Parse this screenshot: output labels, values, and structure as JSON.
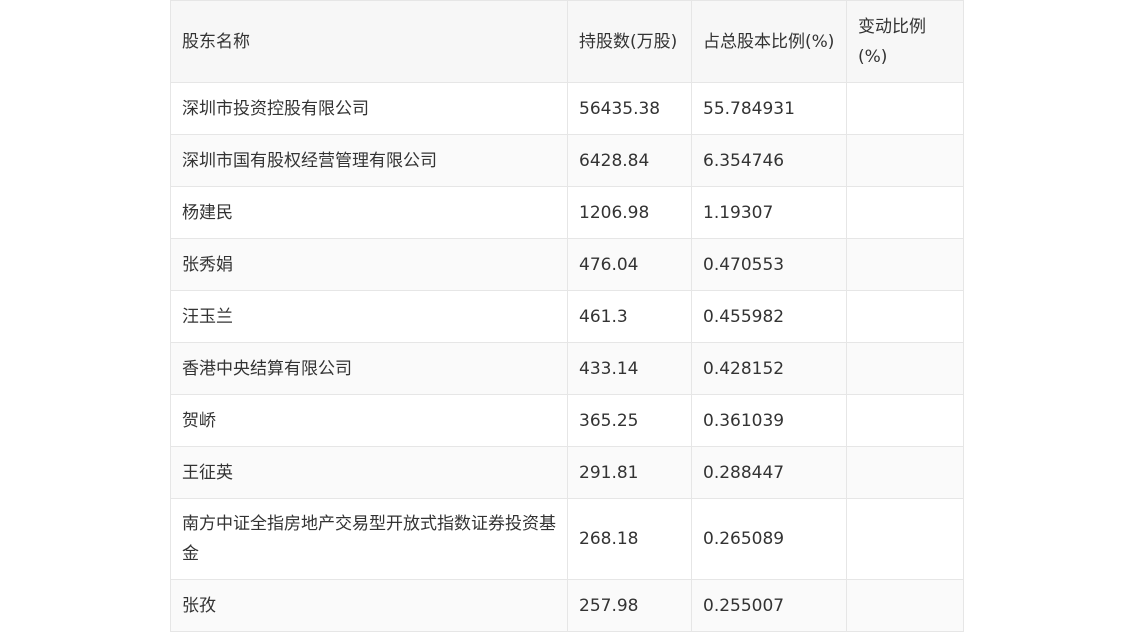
{
  "table": {
    "headers": [
      "股东名称",
      "持股数(万股)",
      "占总股本比例(%)",
      "变动比例(%)"
    ],
    "rows": [
      {
        "name": "深圳市投资控股有限公司",
        "shares": "56435.38",
        "ratio": "55.784931",
        "change": ""
      },
      {
        "name": "深圳市国有股权经营管理有限公司",
        "shares": "6428.84",
        "ratio": "6.354746",
        "change": ""
      },
      {
        "name": "杨建民",
        "shares": "1206.98",
        "ratio": "1.19307",
        "change": ""
      },
      {
        "name": "张秀娟",
        "shares": "476.04",
        "ratio": "0.470553",
        "change": ""
      },
      {
        "name": "汪玉兰",
        "shares": "461.3",
        "ratio": "0.455982",
        "change": ""
      },
      {
        "name": "香港中央结算有限公司",
        "shares": "433.14",
        "ratio": "0.428152",
        "change": ""
      },
      {
        "name": "贺峤",
        "shares": "365.25",
        "ratio": "0.361039",
        "change": ""
      },
      {
        "name": "王征英",
        "shares": "291.81",
        "ratio": "0.288447",
        "change": ""
      },
      {
        "name": "南方中证全指房地产交易型开放式指数证券投资基金",
        "shares": "268.18",
        "ratio": "0.265089",
        "change": ""
      },
      {
        "name": "张孜",
        "shares": "257.98",
        "ratio": "0.255007",
        "change": ""
      }
    ]
  }
}
